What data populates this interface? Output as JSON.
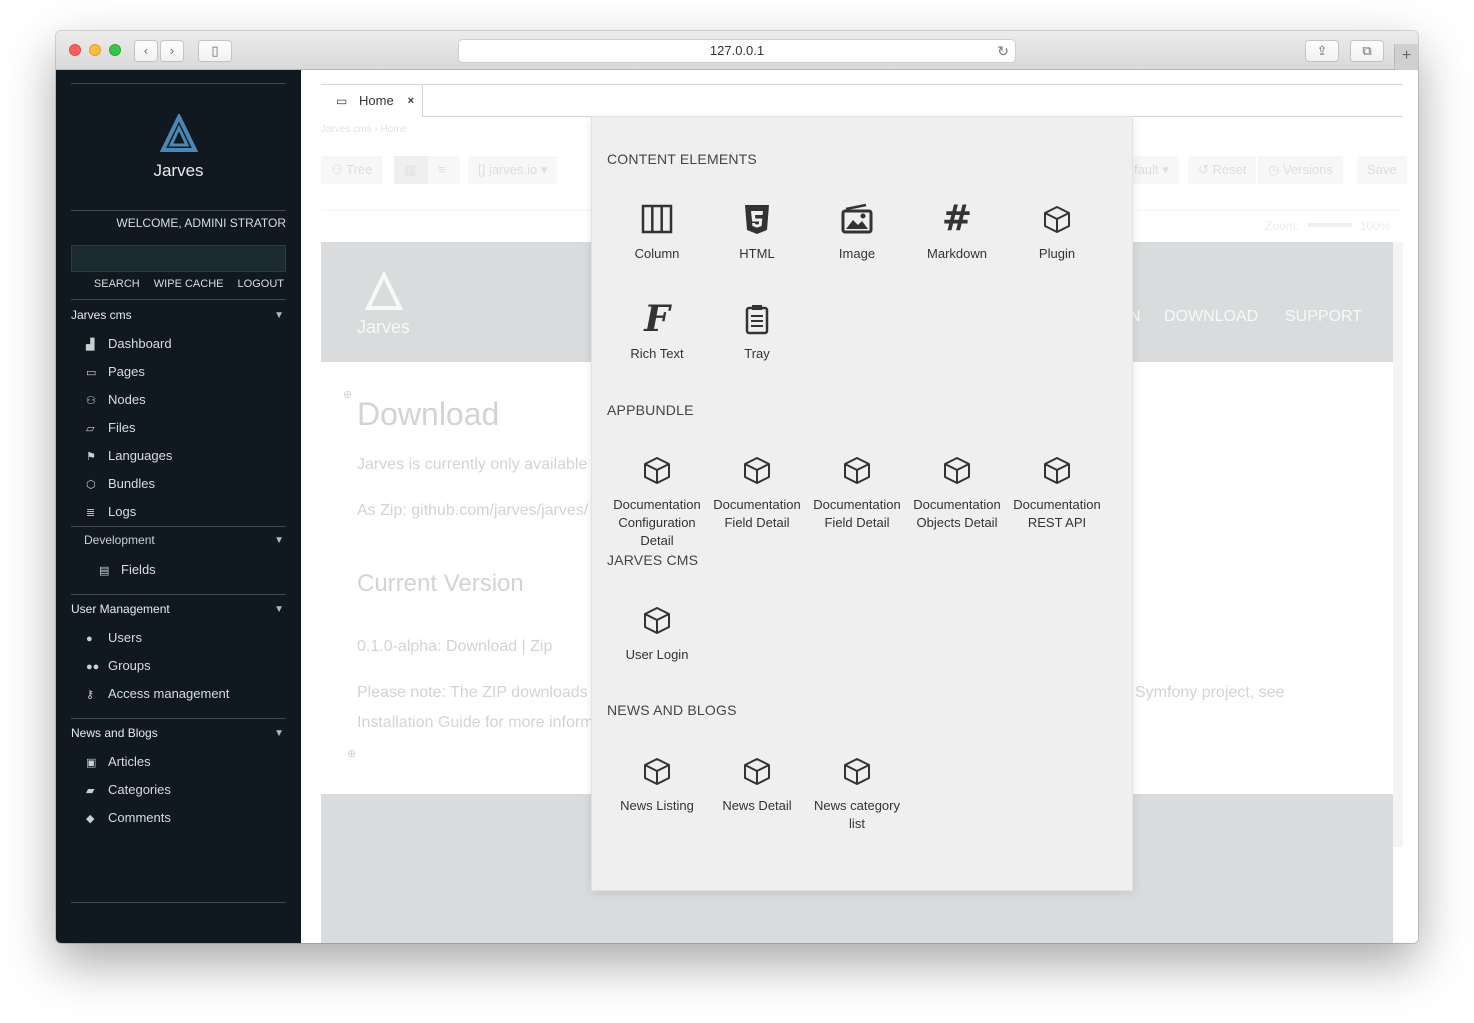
{
  "browser": {
    "url": "127.0.0.1"
  },
  "sidebar": {
    "logo_text": "Jarves",
    "welcome": "WELCOME, ADMINI STRATOR",
    "search_placeholder": "",
    "links": [
      "SEARCH",
      "WIPE CACHE",
      "LOGOUT"
    ],
    "sections": {
      "jarves": {
        "title": "Jarves cms",
        "items": [
          {
            "label": "Dashboard",
            "icon": "dashboard-icon"
          },
          {
            "label": "Pages",
            "icon": "desktop-icon"
          },
          {
            "label": "Nodes",
            "icon": "sitemap-icon"
          },
          {
            "label": "Files",
            "icon": "folder-icon"
          },
          {
            "label": "Languages",
            "icon": "flag-icon"
          },
          {
            "label": "Bundles",
            "icon": "cube-icon"
          },
          {
            "label": "Logs",
            "icon": "list-icon"
          }
        ],
        "sub": {
          "title": "Development",
          "items": [
            {
              "label": "Fields",
              "icon": "form-icon"
            }
          ]
        }
      },
      "users": {
        "title": "User Management",
        "items": [
          {
            "label": "Users",
            "icon": "user-icon"
          },
          {
            "label": "Groups",
            "icon": "group-icon"
          },
          {
            "label": "Access management",
            "icon": "key-icon"
          }
        ]
      },
      "news": {
        "title": "News and Blogs",
        "items": [
          {
            "label": "Articles",
            "icon": "newspaper-icon"
          },
          {
            "label": "Categories",
            "icon": "inbox-icon"
          },
          {
            "label": "Comments",
            "icon": "comments-icon"
          }
        ]
      }
    }
  },
  "tabs": {
    "home": {
      "label": "Home",
      "close": "×"
    }
  },
  "editor": {
    "breadcrumb": "Jarves cms › Home",
    "toolbar": {
      "tree": "Tree",
      "domain": "[] jarves.io",
      "layout": "fault",
      "reset": "Reset",
      "versions": "Versions",
      "save": "Save"
    },
    "zoom_label": "Zoom:",
    "zoom_value": "100%",
    "preview": {
      "logo_text": "Jarves",
      "nav": [
        "N",
        "DOWNLOAD",
        "SUPPORT"
      ],
      "heading": "Download",
      "para1": "Jarves is currently only available a",
      "para2": "As Zip: github.com/jarves/jarves/",
      "heading2": "Current Version",
      "version": "0.1.0-alpha: Download | Zip",
      "note_left": "Please note: The ZIP downloads c",
      "note_right": "Symfony project, see",
      "note_line2": "Installation Guide for more inform"
    }
  },
  "popup": {
    "groups": [
      {
        "title": "CONTENT ELEMENTS",
        "items": [
          {
            "label": "Column",
            "icon": "columns-icon"
          },
          {
            "label": "HTML",
            "icon": "html5-icon"
          },
          {
            "label": "Image",
            "icon": "image-icon"
          },
          {
            "label": "Markdown",
            "icon": "hash-icon"
          },
          {
            "label": "Plugin",
            "icon": "cube-icon"
          },
          {
            "label": "Rich Text",
            "icon": "rich-text-icon"
          },
          {
            "label": "Tray",
            "icon": "clipboard-icon"
          }
        ]
      },
      {
        "title": "APPBUNDLE",
        "items": [
          {
            "label": "Documentation Configuration Detail",
            "icon": "cube-icon"
          },
          {
            "label": "Documentation Field Detail",
            "icon": "cube-icon"
          },
          {
            "label": "Documentation Field Detail",
            "icon": "cube-icon"
          },
          {
            "label": "Documentation Objects Detail",
            "icon": "cube-icon"
          },
          {
            "label": "Documentation REST API",
            "icon": "cube-icon"
          }
        ]
      },
      {
        "title": "JARVES CMS",
        "items": [
          {
            "label": "User Login",
            "icon": "cube-icon"
          }
        ]
      },
      {
        "title": "NEWS AND BLOGS",
        "items": [
          {
            "label": "News Listing",
            "icon": "cube-icon"
          },
          {
            "label": "News Detail",
            "icon": "cube-icon"
          },
          {
            "label": "News category list",
            "icon": "cube-icon"
          }
        ]
      }
    ]
  }
}
